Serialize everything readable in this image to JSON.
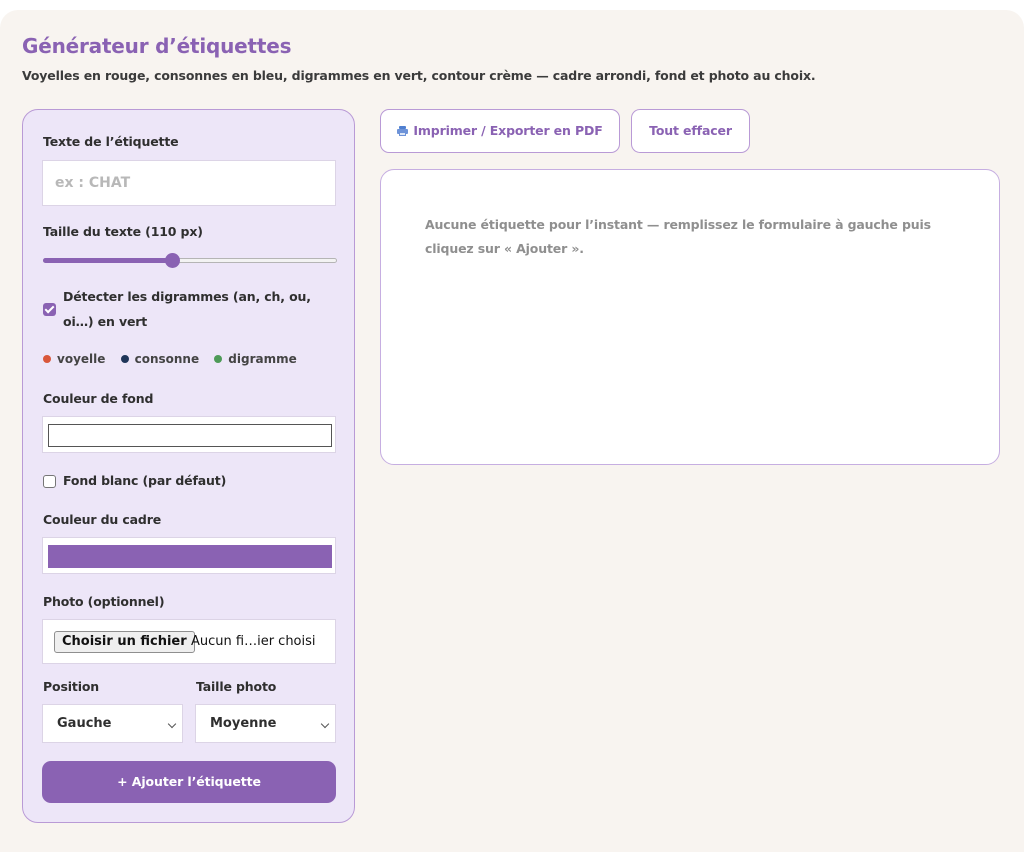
{
  "header": {
    "title": "Générateur d’étiquettes",
    "subtitle": "Voyelles en rouge, consonnes en bleu, digrammes en vert, contour crème — cadre arrondi, fond et photo au choix."
  },
  "form": {
    "text_label": "Texte de l’étiquette",
    "text_value": "",
    "text_placeholder": "ex : CHAT",
    "size_label": "Taille du texte (110 px)",
    "size_slider_fraction": 0.44,
    "digraph_checkbox_label": "Détecter les digrammes (an, ch, ou, oi…) en vert",
    "digraph_checked": true,
    "legend": [
      {
        "label": "voyelle",
        "color": "#d9573b"
      },
      {
        "label": "consonne",
        "color": "#1f3559"
      },
      {
        "label": "digramme",
        "color": "#4e9a58"
      }
    ],
    "bg_color_label": "Couleur de fond",
    "bg_color_value": "#ffffff",
    "white_bg_label": "Fond blanc (par défaut)",
    "white_bg_checked": false,
    "frame_color_label": "Couleur du cadre",
    "frame_color_value": "#8a62b3",
    "photo_label": "Photo (optionnel)",
    "file_button": "Choisir un fichier",
    "file_status": "Aucun fi…ier choisi",
    "position_label": "Position",
    "position_value": "Gauche",
    "photo_size_label": "Taille photo",
    "photo_size_value": "Moyenne",
    "add_button": "+ Ajouter l’étiquette"
  },
  "toolbar": {
    "print_label": "Imprimer / Exporter en PDF",
    "clear_label": "Tout effacer"
  },
  "preview": {
    "empty_message": "Aucune étiquette pour l’instant — remplissez le formulaire à gauche puis cliquez sur « Ajouter »."
  },
  "colors": {
    "accent": "#8a62b3",
    "panel_bg": "#ede6f8",
    "page_bg": "#f8f4f0"
  }
}
